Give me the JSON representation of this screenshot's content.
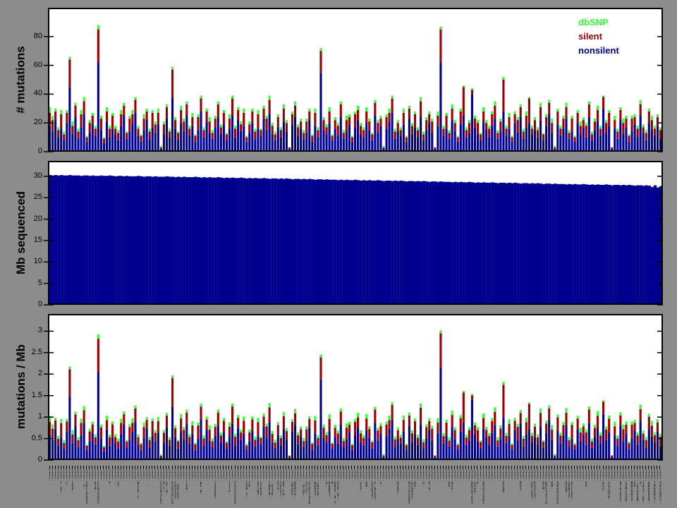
{
  "figure": {
    "background_color": "#8C8C8C",
    "panel_background": "#FFFFFF",
    "axis_color": "#000000"
  },
  "legend": {
    "items": [
      {
        "label": "dbSNP",
        "color": "#33FF33"
      },
      {
        "label": "silent",
        "color": "#990000"
      },
      {
        "label": "nonsilent",
        "color": "#000090"
      }
    ]
  },
  "chart_data": [
    {
      "type": "bar",
      "stacked": true,
      "ylabel": "# mutations",
      "yticks": [
        0,
        20,
        40,
        60,
        80
      ],
      "ylim": [
        0,
        100
      ],
      "n_samples": 215,
      "stack_order_bottom_to_top": [
        "nonsilent",
        "silent",
        "dbSNP"
      ],
      "x_tick_labels": "215 vertical per-sample identifiers, illegible at this resolution",
      "bars_nonsilent_silent_dbsnp": [
        [
          18,
          9,
          4
        ],
        [
          14,
          8,
          3
        ],
        [
          22,
          6,
          2
        ],
        [
          10,
          5,
          2
        ],
        [
          16,
          10,
          3
        ],
        [
          8,
          4,
          2
        ],
        [
          20,
          7,
          2
        ],
        [
          45,
          19,
          2
        ],
        [
          12,
          6,
          3
        ],
        [
          24,
          8,
          2
        ],
        [
          9,
          5,
          2
        ],
        [
          17,
          9,
          3
        ],
        [
          26,
          9,
          3
        ],
        [
          7,
          3,
          1
        ],
        [
          13,
          7,
          2
        ],
        [
          19,
          6,
          2
        ],
        [
          11,
          5,
          2
        ],
        [
          62,
          23,
          3
        ],
        [
          15,
          8,
          2
        ],
        [
          6,
          3,
          1
        ],
        [
          21,
          7,
          3
        ],
        [
          10,
          6,
          2
        ],
        [
          16,
          9,
          2
        ],
        [
          12,
          4,
          2
        ],
        [
          8,
          5,
          2
        ],
        [
          18,
          8,
          3
        ],
        [
          25,
          7,
          2
        ],
        [
          9,
          4,
          1
        ],
        [
          14,
          9,
          2
        ],
        [
          20,
          6,
          3
        ],
        [
          27,
          9,
          2
        ],
        [
          11,
          5,
          2
        ],
        [
          7,
          4,
          1
        ],
        [
          15,
          8,
          3
        ],
        [
          22,
          6,
          2
        ],
        [
          9,
          5,
          2
        ],
        [
          17,
          10,
          2
        ],
        [
          13,
          6,
          2
        ],
        [
          19,
          8,
          3
        ],
        [
          2,
          1,
          1
        ],
        [
          12,
          7,
          2
        ],
        [
          23,
          8,
          2
        ],
        [
          10,
          4,
          2
        ],
        [
          37,
          20,
          2
        ],
        [
          16,
          6,
          2
        ],
        [
          8,
          5,
          1
        ],
        [
          20,
          9,
          3
        ],
        [
          14,
          7,
          2
        ],
        [
          25,
          8,
          2
        ],
        [
          11,
          5,
          2
        ],
        [
          18,
          6,
          3
        ],
        [
          7,
          4,
          1
        ],
        [
          15,
          9,
          2
        ],
        [
          28,
          9,
          2
        ],
        [
          10,
          5,
          2
        ],
        [
          21,
          7,
          2
        ],
        [
          13,
          8,
          3
        ],
        [
          9,
          4,
          2
        ],
        [
          17,
          6,
          2
        ],
        [
          24,
          9,
          2
        ],
        [
          12,
          5,
          2
        ],
        [
          19,
          8,
          2
        ],
        [
          8,
          4,
          1
        ],
        [
          16,
          7,
          3
        ],
        [
          25,
          12,
          2
        ],
        [
          10,
          6,
          2
        ],
        [
          22,
          7,
          2
        ],
        [
          14,
          5,
          2
        ],
        [
          18,
          9,
          3
        ],
        [
          7,
          3,
          1
        ],
        [
          13,
          6,
          2
        ],
        [
          20,
          8,
          2
        ],
        [
          9,
          5,
          2
        ],
        [
          16,
          10,
          3
        ],
        [
          11,
          4,
          1
        ],
        [
          23,
          7,
          2
        ],
        [
          15,
          8,
          2
        ],
        [
          26,
          10,
          3
        ],
        [
          12,
          6,
          2
        ],
        [
          8,
          4,
          2
        ],
        [
          17,
          7,
          2
        ],
        [
          10,
          5,
          2
        ],
        [
          21,
          9,
          3
        ],
        [
          14,
          6,
          2
        ],
        [
          2,
          1,
          0
        ],
        [
          19,
          7,
          2
        ],
        [
          24,
          8,
          3
        ],
        [
          11,
          6,
          2
        ],
        [
          16,
          5,
          2
        ],
        [
          9,
          4,
          2
        ],
        [
          13,
          8,
          2
        ],
        [
          22,
          6,
          2
        ],
        [
          7,
          4,
          1
        ],
        [
          18,
          9,
          3
        ],
        [
          10,
          5,
          2
        ],
        [
          55,
          15,
          2
        ],
        [
          15,
          7,
          2
        ],
        [
          12,
          5,
          2
        ],
        [
          20,
          8,
          3
        ],
        [
          8,
          3,
          1
        ],
        [
          16,
          6,
          2
        ],
        [
          11,
          7,
          2
        ],
        [
          24,
          9,
          2
        ],
        [
          9,
          4,
          2
        ],
        [
          14,
          8,
          3
        ],
        [
          19,
          5,
          2
        ],
        [
          7,
          3,
          1
        ],
        [
          17,
          9,
          2
        ],
        [
          22,
          7,
          3
        ],
        [
          12,
          6,
          2
        ],
        [
          10,
          5,
          2
        ],
        [
          20,
          8,
          3
        ],
        [
          15,
          6,
          2
        ],
        [
          8,
          4,
          1
        ],
        [
          25,
          9,
          2
        ],
        [
          13,
          7,
          2
        ],
        [
          18,
          5,
          2
        ],
        [
          2,
          1,
          1
        ],
        [
          16,
          8,
          2
        ],
        [
          21,
          6,
          3
        ],
        [
          27,
          10,
          2
        ],
        [
          9,
          5,
          2
        ],
        [
          14,
          6,
          2
        ],
        [
          11,
          4,
          2
        ],
        [
          19,
          8,
          3
        ],
        [
          7,
          3,
          1
        ],
        [
          23,
          7,
          2
        ],
        [
          12,
          6,
          2
        ],
        [
          17,
          9,
          2
        ],
        [
          10,
          5,
          2
        ],
        [
          24,
          11,
          3
        ],
        [
          8,
          4,
          2
        ],
        [
          15,
          7,
          2
        ],
        [
          20,
          6,
          2
        ],
        [
          13,
          8,
          2
        ],
        [
          2,
          1,
          0
        ],
        [
          18,
          7,
          3
        ],
        [
          62,
          23,
          2
        ],
        [
          11,
          5,
          2
        ],
        [
          16,
          9,
          2
        ],
        [
          9,
          4,
          2
        ],
        [
          22,
          8,
          3
        ],
        [
          14,
          6,
          2
        ],
        [
          7,
          3,
          1
        ],
        [
          19,
          9,
          2
        ],
        [
          25,
          20,
          1
        ],
        [
          10,
          5,
          2
        ],
        [
          13,
          7,
          2
        ],
        [
          40,
          3,
          1
        ],
        [
          17,
          6,
          2
        ],
        [
          12,
          8,
          2
        ],
        [
          8,
          4,
          1
        ],
        [
          21,
          7,
          3
        ],
        [
          15,
          5,
          2
        ],
        [
          10,
          6,
          2
        ],
        [
          18,
          8,
          2
        ],
        [
          23,
          9,
          3
        ],
        [
          9,
          4,
          2
        ],
        [
          14,
          7,
          2
        ],
        [
          28,
          22,
          2
        ],
        [
          11,
          5,
          2
        ],
        [
          16,
          8,
          3
        ],
        [
          7,
          3,
          1
        ],
        [
          20,
          6,
          2
        ],
        [
          13,
          9,
          2
        ],
        [
          24,
          7,
          2
        ],
        [
          9,
          5,
          2
        ],
        [
          17,
          8,
          3
        ],
        [
          20,
          17,
          1
        ],
        [
          12,
          4,
          2
        ],
        [
          15,
          7,
          2
        ],
        [
          10,
          5,
          2
        ],
        [
          22,
          9,
          3
        ],
        [
          8,
          4,
          1
        ],
        [
          18,
          6,
          2
        ],
        [
          26,
          8,
          2
        ],
        [
          13,
          7,
          3
        ],
        [
          2,
          1,
          1
        ],
        [
          19,
          9,
          2
        ],
        [
          11,
          5,
          2
        ],
        [
          16,
          7,
          2
        ],
        [
          23,
          8,
          3
        ],
        [
          9,
          4,
          2
        ],
        [
          14,
          9,
          2
        ],
        [
          7,
          3,
          1
        ],
        [
          20,
          7,
          2
        ],
        [
          12,
          6,
          3
        ],
        [
          17,
          5,
          2
        ],
        [
          10,
          8,
          2
        ],
        [
          24,
          9,
          2
        ],
        [
          8,
          4,
          2
        ],
        [
          15,
          6,
          2
        ],
        [
          21,
          8,
          3
        ],
        [
          11,
          5,
          2
        ],
        [
          30,
          8,
          1
        ],
        [
          13,
          7,
          2
        ],
        [
          18,
          9,
          2
        ],
        [
          2,
          1,
          0
        ],
        [
          16,
          6,
          3
        ],
        [
          9,
          5,
          2
        ],
        [
          22,
          7,
          2
        ],
        [
          12,
          8,
          3
        ],
        [
          17,
          6,
          2
        ],
        [
          7,
          4,
          1
        ],
        [
          14,
          9,
          2
        ],
        [
          19,
          5,
          2
        ],
        [
          10,
          6,
          2
        ],
        [
          25,
          8,
          3
        ],
        [
          13,
          4,
          2
        ],
        [
          8,
          5,
          2
        ],
        [
          20,
          8,
          2
        ],
        [
          15,
          7,
          3
        ],
        [
          11,
          5,
          2
        ],
        [
          18,
          6,
          2
        ],
        [
          9,
          6,
          2
        ]
      ]
    },
    {
      "type": "bar",
      "stacked": false,
      "ylabel": "Mb sequenced",
      "yticks": [
        0,
        5,
        10,
        15,
        20,
        25,
        30
      ],
      "ylim": [
        0,
        33.6
      ],
      "n_samples": 215,
      "values": [
        30.3,
        30.2,
        30.3,
        30.2,
        30.3,
        30.2,
        30.2,
        30.3,
        30.2,
        30.2,
        30.2,
        30.1,
        30.2,
        30.2,
        30.1,
        30.2,
        30.1,
        30.1,
        30.2,
        30.1,
        30.1,
        30.2,
        30.1,
        30.0,
        30.1,
        30.1,
        30.0,
        30.1,
        30.0,
        30.0,
        30.0,
        30.1,
        30.0,
        29.9,
        30.0,
        30.0,
        29.9,
        30.0,
        29.9,
        29.9,
        29.9,
        30.0,
        29.9,
        29.9,
        29.8,
        29.9,
        29.8,
        29.9,
        29.8,
        29.8,
        29.8,
        29.9,
        29.8,
        29.7,
        29.8,
        29.7,
        29.8,
        29.7,
        29.7,
        29.8,
        29.7,
        29.6,
        29.7,
        29.6,
        29.7,
        29.6,
        29.6,
        29.7,
        29.6,
        29.5,
        29.6,
        29.5,
        29.6,
        29.5,
        29.5,
        29.6,
        29.5,
        29.4,
        29.5,
        29.5,
        29.4,
        29.5,
        29.4,
        29.5,
        29.4,
        29.3,
        29.4,
        29.4,
        29.3,
        29.4,
        29.3,
        29.4,
        29.3,
        29.2,
        29.3,
        29.3,
        29.2,
        29.3,
        29.2,
        29.2,
        29.2,
        29.1,
        29.2,
        29.1,
        29.2,
        29.1,
        29.1,
        29.2,
        29.1,
        29.0,
        29.1,
        29.0,
        29.1,
        29.0,
        29.0,
        29.1,
        29.0,
        28.9,
        29.0,
        29.0,
        28.9,
        29.0,
        28.9,
        29.0,
        28.9,
        28.8,
        28.9,
        28.9,
        28.8,
        28.9,
        28.8,
        28.9,
        28.8,
        28.7,
        28.8,
        28.8,
        28.7,
        28.8,
        28.7,
        28.7,
        28.7,
        28.6,
        28.7,
        28.6,
        28.7,
        28.6,
        28.6,
        28.7,
        28.6,
        28.5,
        28.6,
        28.5,
        28.6,
        28.5,
        28.5,
        28.6,
        28.5,
        28.4,
        28.5,
        28.5,
        28.4,
        28.5,
        28.4,
        28.5,
        28.4,
        28.3,
        28.4,
        28.4,
        28.3,
        28.4,
        28.3,
        28.4,
        28.3,
        28.2,
        28.3,
        28.3,
        28.2,
        28.3,
        28.2,
        28.2,
        28.2,
        28.1,
        28.2,
        28.1,
        28.2,
        28.1,
        28.1,
        28.2,
        28.1,
        28.0,
        28.1,
        28.0,
        28.1,
        28.0,
        28.0,
        28.1,
        28.0,
        27.9,
        28.0,
        28.0,
        27.9,
        28.0,
        27.9,
        28.0,
        27.9,
        27.8,
        27.9,
        27.9,
        27.8,
        27.9,
        27.8,
        27.5,
        27.9,
        27.4,
        27.7
      ]
    },
    {
      "type": "bar",
      "stacked": true,
      "ylabel": "mutations / Mb",
      "yticks": [
        0,
        0.5,
        1,
        1.5,
        2,
        2.5,
        3
      ],
      "ylim": [
        0,
        3.4
      ],
      "n_samples": 215,
      "stack_order_bottom_to_top": [
        "nonsilent",
        "silent",
        "dbSNP"
      ],
      "values_note": "each stacked segment equals the corresponding '# mutations' segment divided by the sample's 'Mb sequenced' value"
    }
  ]
}
